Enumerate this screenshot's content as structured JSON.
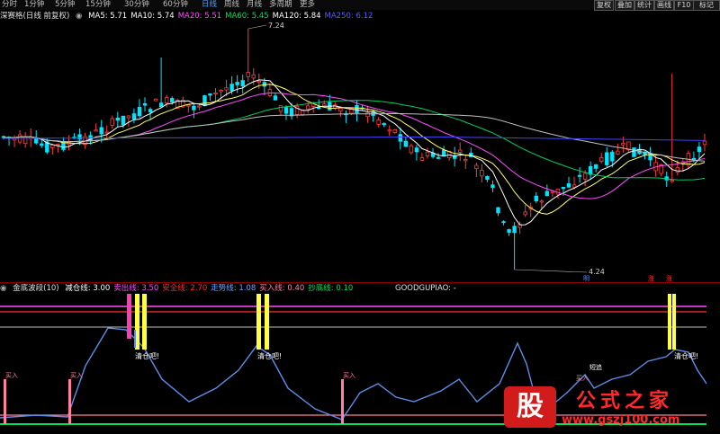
{
  "toolbar": {
    "periods": [
      "分时",
      "1分钟",
      "5分钟",
      "15分钟",
      "30分钟",
      "60分钟",
      "日线",
      "周线",
      "月线",
      "多周期",
      "更多"
    ],
    "active_period": "日线",
    "buttons": [
      "复权",
      "叠加",
      "统计",
      "画线",
      "F10",
      "标记"
    ]
  },
  "main_info": {
    "title": "深赛格(日线 前复权)",
    "indicators": [
      {
        "label": "MA5: 5.71",
        "color": "#ffffff"
      },
      {
        "label": "MA10: 5.74",
        "color": "#ffffff"
      },
      {
        "label": "MA20: 5.51",
        "color": "#ff4dff"
      },
      {
        "label": "MA60: 5.45",
        "color": "#00e060"
      },
      {
        "label": "MA120: 5.84",
        "color": "#ffffff"
      },
      {
        "label": "MA250: 6.12",
        "color": "#5a5aff"
      }
    ],
    "high_label": "7.24",
    "low_label": "4.24"
  },
  "sub_info": {
    "title": "金底波段(10)",
    "indicators": [
      {
        "label": "减仓线: 3.00",
        "color": "#ffffff"
      },
      {
        "label": "卖出线: 3.50",
        "color": "#ff4dff"
      },
      {
        "label": "安全线: 2.70",
        "color": "#ff3030"
      },
      {
        "label": "走势线: 1.08",
        "color": "#6aa8ff"
      },
      {
        "label": "买入线: 0.40",
        "color": "#ff80a0"
      },
      {
        "label": "抄底线: 0.10",
        "color": "#00e060"
      }
    ],
    "extra": "GOODGUPIAO: -"
  },
  "markers": {
    "sell_text": "清仓吧!",
    "buy_text": "买入",
    "warn_text": "短追",
    "ming_text": "明",
    "red_marker": "涨"
  },
  "watermark": {
    "badge": "股",
    "title": "公式之家",
    "url": "www.gszj100.com"
  },
  "colors": {
    "up": "#ff3c3c",
    "up_hollow": "#ff3c3c",
    "down": "#00e5ff",
    "ma5": "#ffffff",
    "ma10": "#ffff66",
    "ma20": "#ff4dff",
    "ma60": "#00d060",
    "ma120": "#bfbfbf",
    "ma250": "#4444ff",
    "trend": "#5f8ee8",
    "yellow": "#ffff44",
    "pink": "#ff3cb4"
  }
}
